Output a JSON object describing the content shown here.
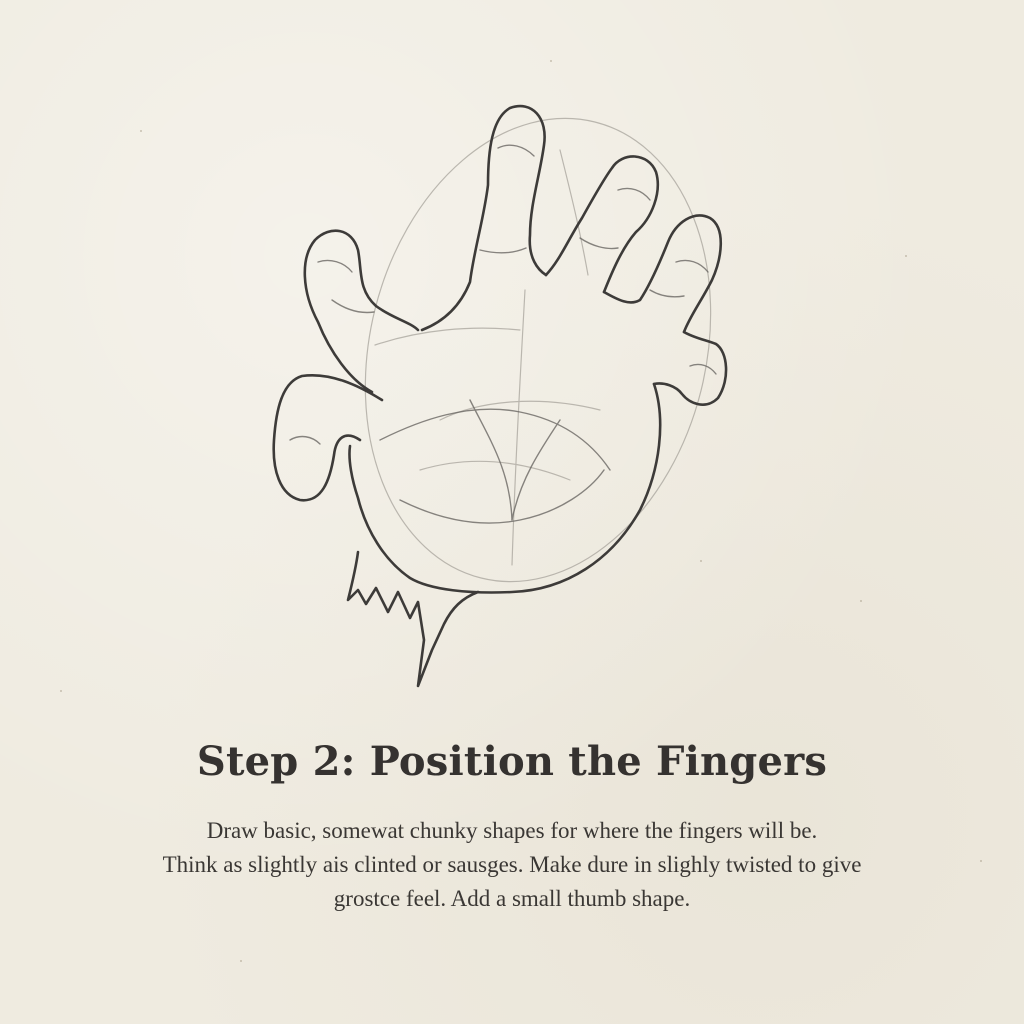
{
  "step": {
    "title": "Step 2: Position the Fingers",
    "lines": [
      "Draw basic, somewat chunky shapes for where the fingers will be.",
      "Think as slightly ais clinted or sausges. Make dure in slighly twisted to give",
      "grostce feel. Add a small thumb shape."
    ]
  },
  "colors": {
    "paper": "#efebe0",
    "pencil": "#3d3b39",
    "guide": "#a8a49c",
    "text": "#353230"
  },
  "illustration": {
    "subject": "pencil sketch of a hand with chunky fingers"
  }
}
